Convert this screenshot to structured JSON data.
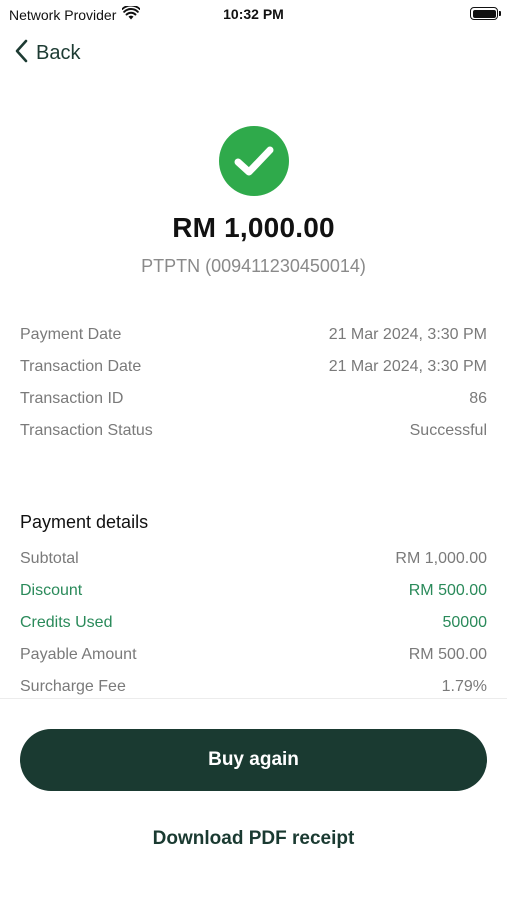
{
  "status_bar": {
    "carrier": "Network Provider",
    "time": "10:32 PM",
    "wifi_icon": "wifi-icon",
    "battery_icon": "battery-icon"
  },
  "nav": {
    "back_label": "Back",
    "back_icon": "chevron-left-icon"
  },
  "summary": {
    "status_icon": "check-circle-icon",
    "amount": "RM 1,000.00",
    "payee": "PTPTN (009411230450014)"
  },
  "info_rows": [
    {
      "label": "Payment Date",
      "value": "21 Mar 2024, 3:30 PM"
    },
    {
      "label": "Transaction Date",
      "value": "21 Mar 2024, 3:30 PM"
    },
    {
      "label": "Transaction ID",
      "value": "86"
    },
    {
      "label": "Transaction Status",
      "value": "Successful"
    }
  ],
  "payment_details": {
    "title": "Payment details",
    "rows": [
      {
        "label": "Subtotal",
        "value": "RM 1,000.00"
      },
      {
        "label": "Discount",
        "value": "RM 500.00"
      },
      {
        "label": "Credits Used",
        "value": "50000"
      },
      {
        "label": "Payable Amount",
        "value": "RM 500.00"
      },
      {
        "label": "Surcharge Fee",
        "value": "1.79%"
      }
    ]
  },
  "actions": {
    "buy_again_label": "Buy again",
    "download_label": "Download PDF receipt"
  },
  "colors": {
    "accent_dark": "#1a3a31",
    "success_green": "#2faa4b",
    "highlight_text": "#2a8a5a",
    "muted_text": "#7a7a7a"
  }
}
